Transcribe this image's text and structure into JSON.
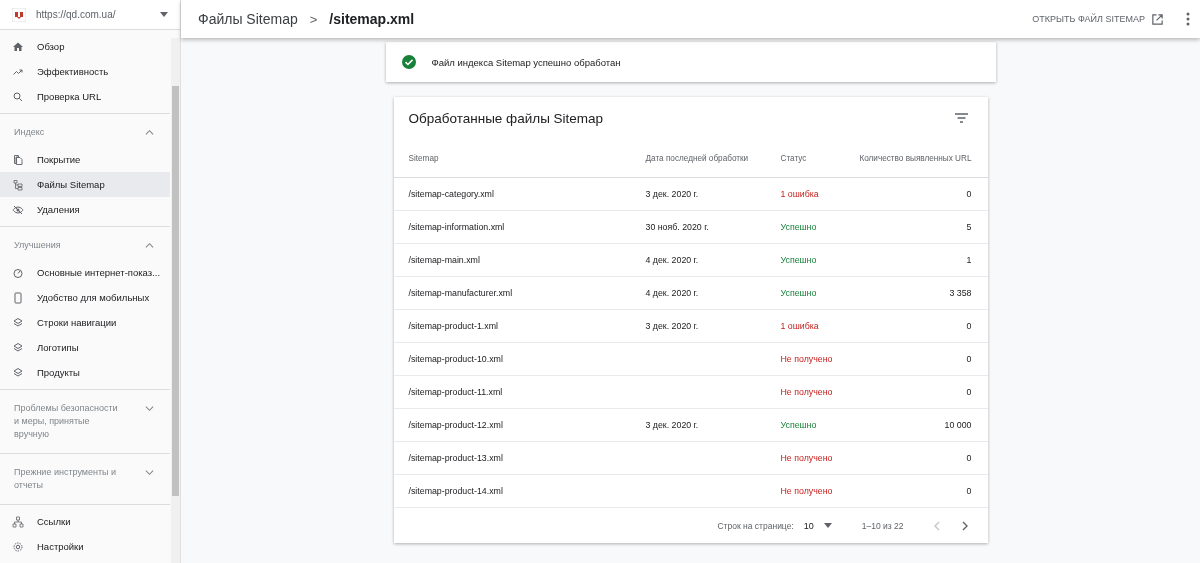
{
  "property": {
    "url": "https://qd.com.ua/"
  },
  "sidebar": {
    "groups": [
      {
        "items": [
          {
            "label": "Обзор",
            "selected": false
          },
          {
            "label": "Эффективность",
            "selected": false
          },
          {
            "label": "Проверка URL",
            "selected": false
          }
        ]
      },
      {
        "title": "Индекс",
        "expanded": true,
        "items": [
          {
            "label": "Покрытие",
            "selected": false
          },
          {
            "label": "Файлы Sitemap",
            "selected": true
          },
          {
            "label": "Удаления",
            "selected": false
          }
        ]
      },
      {
        "title": "Улучшения",
        "expanded": true,
        "items": [
          {
            "label": "Основные интернет-показ...",
            "selected": false
          },
          {
            "label": "Удобство для мобильных",
            "selected": false
          },
          {
            "label": "Строки навигации",
            "selected": false
          },
          {
            "label": "Логотипы",
            "selected": false
          },
          {
            "label": "Продукты",
            "selected": false
          }
        ]
      },
      {
        "title": "Проблемы безопасности и меры, принятые вручную",
        "expanded": false
      },
      {
        "title": "Прежние инструменты и отчеты",
        "expanded": false
      },
      {
        "items": [
          {
            "label": "Ссылки",
            "selected": false
          },
          {
            "label": "Настройки",
            "selected": false
          }
        ]
      }
    ]
  },
  "breadcrumb": {
    "parent": "Файлы Sitemap",
    "separator": ">",
    "current": "/sitemap.xml"
  },
  "open_button": "ОТКРЫТЬ ФАЙЛ SITEMAP",
  "banner": {
    "text": "Файл индекса Sitemap успешно обработан"
  },
  "table": {
    "title": "Обработанные файлы Sitemap",
    "columns": [
      "Sitemap",
      "Дата последней обработки",
      "Статус",
      "Количество выявленных URL"
    ],
    "rows": [
      {
        "sitemap": "/sitemap-category.xml",
        "date": "3 дек. 2020 г.",
        "status": "1 ошибка",
        "kind": "error",
        "urls": "0"
      },
      {
        "sitemap": "/sitemap-information.xml",
        "date": "30 нояб. 2020 г.",
        "status": "Успешно",
        "kind": "success",
        "urls": "5"
      },
      {
        "sitemap": "/sitemap-main.xml",
        "date": "4 дек. 2020 г.",
        "status": "Успешно",
        "kind": "success",
        "urls": "1"
      },
      {
        "sitemap": "/sitemap-manufacturer.xml",
        "date": "4 дек. 2020 г.",
        "status": "Успешно",
        "kind": "success",
        "urls": "3 358"
      },
      {
        "sitemap": "/sitemap-product-1.xml",
        "date": "3 дек. 2020 г.",
        "status": "1 ошибка",
        "kind": "error",
        "urls": "0"
      },
      {
        "sitemap": "/sitemap-product-10.xml",
        "status": "Не получено",
        "kind": "error",
        "urls": "0"
      },
      {
        "sitemap": "/sitemap-product-11.xml",
        "status": "Не получено",
        "kind": "error",
        "urls": "0"
      },
      {
        "sitemap": "/sitemap-product-12.xml",
        "date": "3 дек. 2020 г.",
        "status": "Успешно",
        "kind": "success",
        "urls": "10 000"
      },
      {
        "sitemap": "/sitemap-product-13.xml",
        "status": "Не получено",
        "kind": "error",
        "urls": "0"
      },
      {
        "sitemap": "/sitemap-product-14.xml",
        "status": "Не получено",
        "kind": "error",
        "urls": "0"
      }
    ],
    "pagination": {
      "rows_label": "Строк на странице:",
      "rows_value": "10",
      "range": "1–10 из 22",
      "prev_disabled": true
    }
  }
}
